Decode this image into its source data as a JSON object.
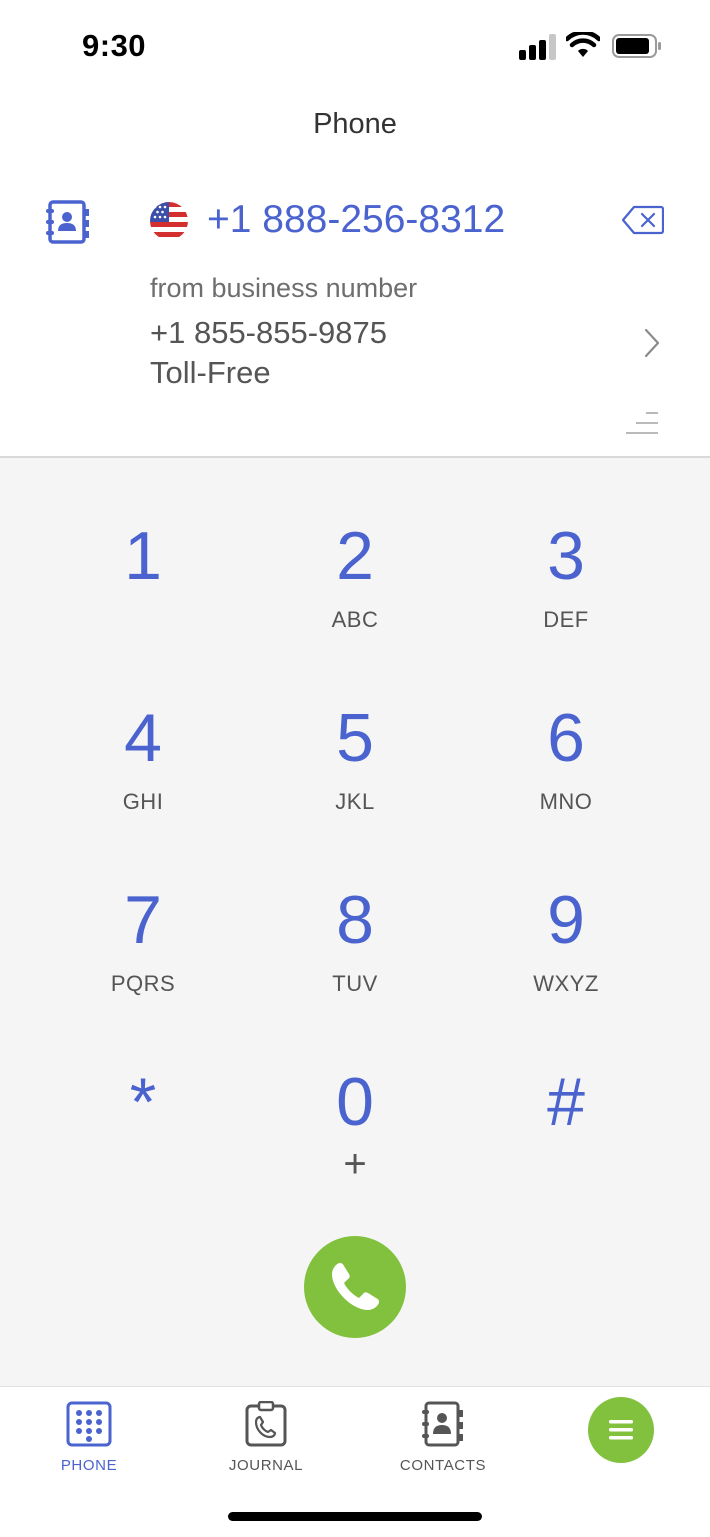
{
  "status_bar": {
    "time": "9:30"
  },
  "header": {
    "title": "Phone"
  },
  "dialer": {
    "dialed_number": "+1 888-256-8312",
    "from_label": "from business number",
    "from_number": "+1 855-855-9875",
    "from_type": "Toll-Free"
  },
  "keypad": {
    "keys": [
      {
        "digit": "1",
        "letters": ""
      },
      {
        "digit": "2",
        "letters": "ABC"
      },
      {
        "digit": "3",
        "letters": "DEF"
      },
      {
        "digit": "4",
        "letters": "GHI"
      },
      {
        "digit": "5",
        "letters": "JKL"
      },
      {
        "digit": "6",
        "letters": "MNO"
      },
      {
        "digit": "7",
        "letters": "PQRS"
      },
      {
        "digit": "8",
        "letters": "TUV"
      },
      {
        "digit": "9",
        "letters": "WXYZ"
      },
      {
        "digit": "*",
        "letters": ""
      },
      {
        "digit": "0",
        "plus": "+"
      },
      {
        "digit": "#",
        "letters": ""
      }
    ]
  },
  "tabs": [
    {
      "label": "PHONE",
      "icon": "keypad-icon",
      "active": true
    },
    {
      "label": "JOURNAL",
      "icon": "journal-icon",
      "active": false
    },
    {
      "label": "CONTACTS",
      "icon": "contacts-icon",
      "active": false
    }
  ],
  "colors": {
    "accent": "#4a63cf",
    "call_green": "#82c13d",
    "keypad_bg": "#f5f5f5"
  }
}
